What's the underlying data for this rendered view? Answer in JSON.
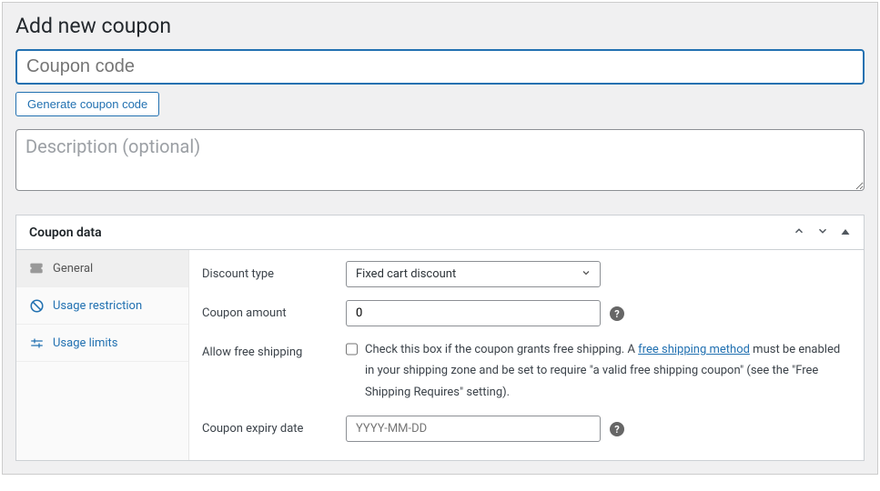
{
  "header": {
    "title": "Add new coupon"
  },
  "coupon_code": {
    "placeholder": "Coupon code",
    "value": ""
  },
  "generate_button": {
    "label": "Generate coupon code"
  },
  "description": {
    "placeholder": "Description (optional)",
    "value": ""
  },
  "metabox": {
    "title": "Coupon data",
    "tabs": {
      "general": {
        "label": "General"
      },
      "usage_restriction": {
        "label": "Usage restriction"
      },
      "usage_limits": {
        "label": "Usage limits"
      }
    },
    "fields": {
      "discount_type": {
        "label": "Discount type",
        "value": "Fixed cart discount"
      },
      "coupon_amount": {
        "label": "Coupon amount",
        "value": "0"
      },
      "free_shipping": {
        "label": "Allow free shipping",
        "desc_prefix": "Check this box if the coupon grants free shipping. A ",
        "link_text": "free shipping method",
        "desc_suffix": " must be enabled in your shipping zone and be set to require \"a valid free shipping coupon\" (see the \"Free Shipping Requires\" setting)."
      },
      "expiry_date": {
        "label": "Coupon expiry date",
        "placeholder": "YYYY-MM-DD",
        "value": ""
      }
    }
  }
}
